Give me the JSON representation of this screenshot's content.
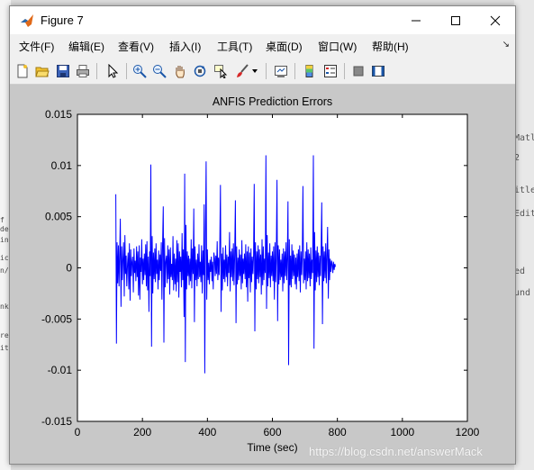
{
  "window": {
    "title": "Figure 7"
  },
  "menu": [
    {
      "label": "文件(F)"
    },
    {
      "label": "编辑(E)"
    },
    {
      "label": "查看(V)"
    },
    {
      "label": "插入(I)"
    },
    {
      "label": "工具(T)"
    },
    {
      "label": "桌面(D)"
    },
    {
      "label": "窗口(W)"
    },
    {
      "label": "帮助(H)"
    }
  ],
  "toolbar_icons": [
    "new-figure-icon",
    "open-file-icon",
    "save-icon",
    "print-icon",
    "pointer-icon",
    "zoom-in-icon",
    "zoom-out-icon",
    "pan-icon",
    "rotate-icon",
    "data-cursor-icon",
    "brush-icon",
    "link-icon",
    "colorbar-icon",
    "legend-icon",
    "hide-plot-tools-icon",
    "show-plot-tools-icon"
  ],
  "background": {
    "right_texts": [
      "Matl",
      "2",
      "itle",
      "Edit",
      "ed",
      "und"
    ],
    "left_texts": [
      "f",
      "de",
      "in",
      "ic",
      "n/",
      "nk",
      "re",
      "it"
    ]
  },
  "watermark": "https://blog.csdn.net/answerMack",
  "colors": {
    "line": "#0000ff",
    "axes_bg": "#ffffff",
    "figure_bg": "#c8c8c8"
  },
  "chart_data": {
    "type": "line",
    "title": "ANFIS Prediction Errors",
    "xlabel": "Time (sec)",
    "ylabel": "",
    "xlim": [
      0,
      1200
    ],
    "ylim": [
      -0.015,
      0.015
    ],
    "xticks": [
      "0",
      "200",
      "400",
      "600",
      "800",
      "1000",
      "1200"
    ],
    "yticks": [
      "0.015",
      "0.01",
      "0.005",
      "0",
      "-0.005",
      "-0.01",
      "-0.015"
    ],
    "grid": false,
    "series": [
      {
        "x_start": 118,
        "x_step": 2,
        "values": [
          0.0072,
          -0.0074,
          0.0025,
          -0.0015,
          0.0022,
          -0.0018,
          0.0012,
          0.0048,
          -0.0038,
          0.0021,
          -0.0012,
          0.0008,
          0.0025,
          -0.0028,
          0.0032,
          -0.0006,
          0.0012,
          -0.0018,
          0.0004,
          0.0015,
          -0.0021,
          0.0024,
          -0.0032,
          0.0018,
          -0.0008,
          0.0006,
          0.0011,
          -0.0024,
          0.0019,
          -0.0005,
          0.0007,
          -0.0013,
          0.0021,
          -0.0009,
          0.0016,
          -0.0027,
          0.0022,
          -0.0031,
          0.001,
          -0.0004,
          0.0028,
          -0.0016,
          0.0009,
          -0.0012,
          0.0014,
          -0.0007,
          0.0023,
          -0.0018,
          0.0026,
          -0.0022,
          0.0011,
          -0.0043,
          0.0016,
          -0.0008,
          0.0101,
          -0.0077,
          0.0031,
          -0.0025,
          0.0015,
          -0.0011,
          0.0019,
          -0.0014,
          0.0024,
          -0.0006,
          0.0008,
          -0.0021,
          0.0017,
          -0.0012,
          0.0013,
          -0.0003,
          0.0025,
          -0.0031,
          0.0021,
          0.006,
          -0.0073,
          0.0029,
          -0.0019,
          0.0006,
          0.0012,
          -0.0015,
          0.0022,
          -0.0011,
          0.0018,
          -0.0026,
          0.002,
          -0.0009,
          0.0004,
          -0.0012,
          0.0031,
          -0.0022,
          0.0014,
          -0.0016,
          0.0009,
          -0.0023,
          0.0027,
          -0.0014,
          0.0024,
          -0.0029,
          0.0016,
          -0.0004,
          0.0011,
          -0.0019,
          0.0034,
          -0.0012,
          0.0018,
          -0.0048,
          0.0092,
          -0.0092,
          0.0042,
          -0.0021,
          0.0016,
          -0.0008,
          0.0012,
          -0.0017,
          0.0009,
          -0.0013,
          0.0028,
          -0.002,
          0.0019,
          -0.0006,
          0.0058,
          -0.0053,
          0.0021,
          -0.0012,
          0.0008,
          -0.0018,
          0.0014,
          -0.0011,
          0.0023,
          -0.0009,
          0.0006,
          -0.0014,
          0.0022,
          -0.0025,
          0.0017,
          -0.0007,
          0.0062,
          -0.0103,
          0.0034,
          0.0104,
          -0.0031,
          0.0018,
          -0.0012,
          0.0005,
          -0.0016,
          0.0008,
          -0.0004,
          0.0011,
          -0.0013,
          0.0006,
          -0.0021,
          0.0015,
          0.0009,
          -0.0008,
          0.0012,
          -0.0006,
          0.0026,
          -0.0012,
          0.001,
          -0.0007,
          0.0016,
          0.0081,
          -0.0043,
          0.0014,
          -0.0022,
          0.002,
          -0.0011,
          0.0008,
          -0.0014,
          0.0022,
          -0.0009,
          0.0013,
          -0.0018,
          0.0011,
          -0.0005,
          0.0035,
          -0.0023,
          0.0016,
          -0.0009,
          0.0019,
          -0.0013,
          0.0024,
          -0.0017,
          0.0012,
          0.0066,
          -0.0054,
          0.0021,
          -0.0016,
          0.001,
          -0.0012,
          0.0018,
          -0.0008,
          0.0013,
          -0.0021,
          0.0027,
          -0.0015,
          0.0009,
          -0.0006,
          0.0014,
          -0.0011,
          0.0023,
          -0.0019,
          0.0016,
          -0.0033,
          0.0021,
          -0.001,
          0.0015,
          -0.0024,
          0.0019,
          -0.0014,
          0.0011,
          -0.0006,
          0.0013,
          0.0082,
          -0.0062,
          0.0025,
          -0.0021,
          0.0016,
          -0.0011,
          0.0022,
          -0.0015,
          0.0018,
          -0.0009,
          0.0013,
          -0.0026,
          0.0028,
          -0.0017,
          0.0021,
          -0.0012,
          0.0009,
          -0.0005,
          0.011,
          -0.004,
          0.0032,
          -0.0018,
          0.0015,
          -0.001,
          0.0024,
          -0.0019,
          0.0012,
          -0.0008,
          0.0016,
          -0.0013,
          0.0021,
          -0.0031,
          0.0025,
          -0.0014,
          0.0009,
          0.0086,
          -0.0052,
          0.0022,
          -0.0016,
          0.0018,
          -0.0012,
          0.0008,
          -0.0009,
          0.0014,
          -0.0023,
          0.0019,
          -0.0015,
          0.0016,
          -0.0008,
          0.0025,
          -0.0012,
          0.0011,
          0.0065,
          -0.0095,
          0.0028,
          -0.0017,
          0.0012,
          -0.0019,
          0.0023,
          -0.0011,
          0.0017,
          -0.0008,
          0.0013,
          -0.0016,
          0.001,
          -0.0021,
          0.0014,
          -0.0009,
          0.0018,
          -0.0013,
          0.0022,
          -0.0024,
          0.0016,
          -0.0007,
          0.0012,
          0.008,
          -0.0015,
          0.0009,
          -0.0012,
          0.0016,
          -0.0021,
          0.0025,
          -0.0013,
          0.0018,
          -0.001,
          0.0014,
          -0.0018,
          0.002,
          -0.0011,
          0.0008,
          -0.0005,
          0.011,
          -0.0079,
          0.0035,
          -0.0022,
          0.0017,
          -0.0014,
          0.0021,
          -0.0009,
          0.0015,
          -0.0017,
          0.0012,
          -0.0008,
          0.0019,
          0.0064,
          -0.0055,
          0.0021,
          -0.0013,
          0.0016,
          -0.001,
          0.0024,
          -0.0015,
          0.0012,
          0.004,
          -0.003,
          0.0018,
          -0.0012,
          0.0009,
          -0.0004,
          0.0007,
          0.0003,
          -0.0005,
          0.0006,
          -0.0002,
          0.0004,
          0.0001
        ]
      }
    ]
  }
}
